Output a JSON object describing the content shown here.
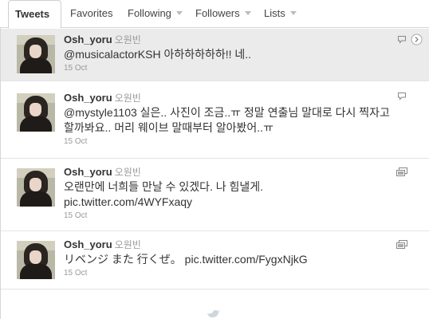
{
  "tabs": [
    {
      "label": "Tweets",
      "active": true,
      "dropdown": false
    },
    {
      "label": "Favorites",
      "active": false,
      "dropdown": false
    },
    {
      "label": "Following",
      "active": false,
      "dropdown": true
    },
    {
      "label": "Followers",
      "active": false,
      "dropdown": true
    },
    {
      "label": "Lists",
      "active": false,
      "dropdown": true
    }
  ],
  "tweets": [
    {
      "username": "Osh_yoru",
      "realname": "오원빈",
      "text": "@musicalactorKSH 아하하하하하!! 네..",
      "date": "15 Oct",
      "highlighted": true,
      "icon": "speech-bubble-icon"
    },
    {
      "username": "Osh_yoru",
      "realname": "오원빈",
      "text": "@mystyle1103 실은.. 사진이 조금..ㅠ 정말 연출님 말대로 다시 찍자고 할까봐요.. 머리 웨이브 말때부터 알아봤어..ㅠ",
      "date": "15 Oct",
      "highlighted": false,
      "icon": "speech-bubble-icon"
    },
    {
      "username": "Osh_yoru",
      "realname": "오원빈",
      "text": "오랜만에 너희들 만날 수 있겠다. 나 힘낼게.\npic.twitter.com/4WYFxaqy",
      "date": "15 Oct",
      "highlighted": false,
      "icon": "photo-gallery-icon"
    },
    {
      "username": "Osh_yoru",
      "realname": "오원빈",
      "text": "リベンジ また 行くぜ。 pic.twitter.com/FygxNjkG",
      "date": "15 Oct",
      "highlighted": false,
      "icon": "photo-gallery-icon"
    }
  ],
  "colors": {
    "highlight_bg": "#ebebeb",
    "username": "#333333",
    "meta": "#999999",
    "border": "#e4e4e4"
  }
}
